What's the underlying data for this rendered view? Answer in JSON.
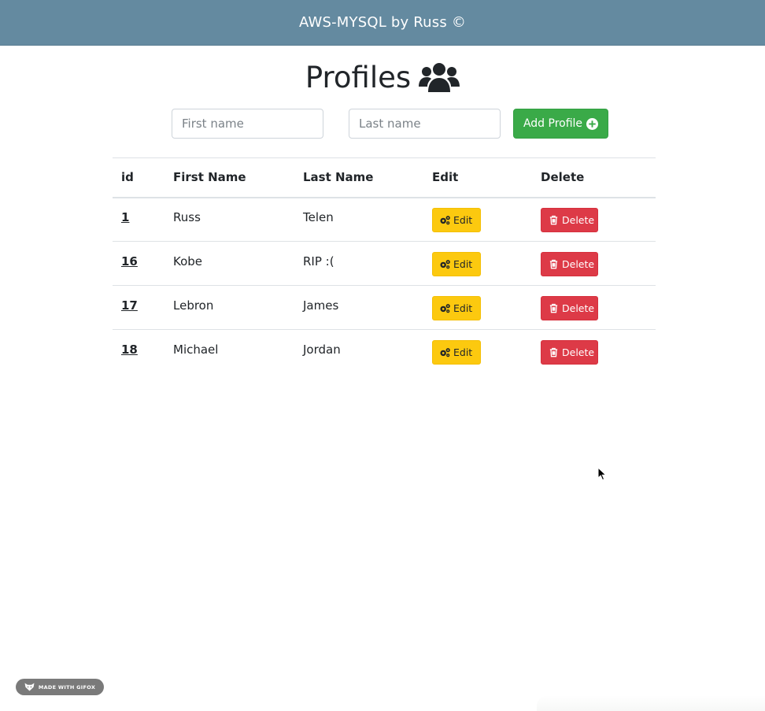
{
  "header": {
    "title": "AWS-MYSQL by Russ ©"
  },
  "page": {
    "title": "Profiles",
    "title_icon": "users-icon"
  },
  "form": {
    "first_name_placeholder": "First name",
    "first_name_value": "",
    "last_name_placeholder": "Last name",
    "last_name_value": "",
    "add_button_label": "Add Profile",
    "add_button_icon": "plus-circle-icon"
  },
  "table": {
    "columns": [
      "id",
      "First Name",
      "Last Name",
      "Edit",
      "Delete"
    ],
    "rows": [
      {
        "id": "1",
        "first_name": "Russ",
        "last_name": "Telen",
        "edit_label": "Edit",
        "delete_label": "Delete"
      },
      {
        "id": "16",
        "first_name": "Kobe",
        "last_name": "RIP :(",
        "edit_label": "Edit",
        "delete_label": "Delete"
      },
      {
        "id": "17",
        "first_name": "Lebron",
        "last_name": "James",
        "edit_label": "Edit",
        "delete_label": "Delete"
      },
      {
        "id": "18",
        "first_name": "Michael",
        "last_name": "Jordan",
        "edit_label": "Edit",
        "delete_label": "Delete"
      }
    ],
    "edit_icon": "gears-icon",
    "delete_icon": "trash-icon"
  },
  "badge": {
    "label": "MADE WITH GIFOX",
    "icon": "fox-icon"
  },
  "colors": {
    "header_bg": "#648aa0",
    "add_button": "#3aaa48",
    "edit_button": "#fcc90f",
    "delete_button": "#dd3a47"
  }
}
